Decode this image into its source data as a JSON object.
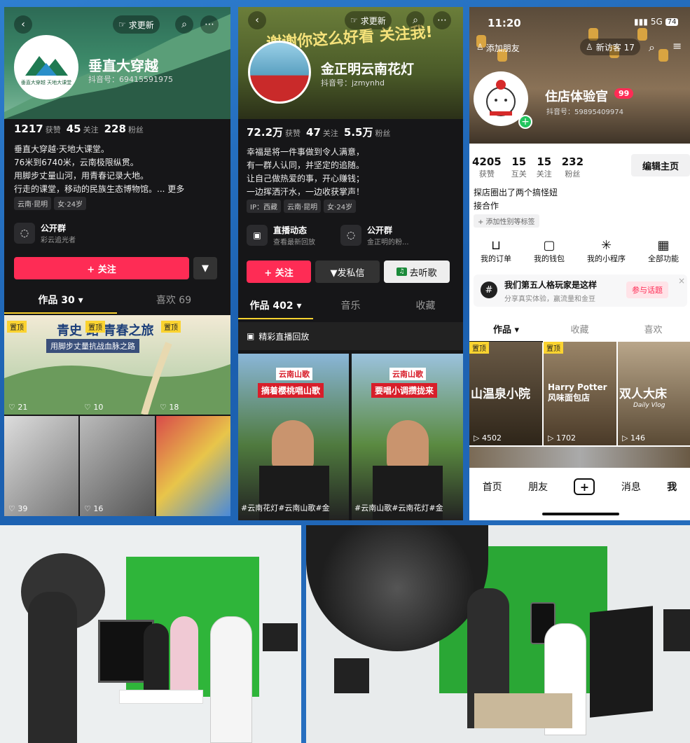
{
  "p1": {
    "name": "垂直大穿越",
    "douyin_id": "抖音号：69415591975",
    "update_btn": "求更新",
    "logo_text": "垂直大穿越 天地大课堂",
    "stats": {
      "likes": "1217",
      "likes_l": "获赞",
      "following": "45",
      "following_l": "关注",
      "fans": "228",
      "fans_l": "粉丝"
    },
    "bio": [
      "垂直大穿越·天地大课堂。",
      "76米到6740米，云南极限纵贯。",
      "用脚步丈量山河，用青春记录大地。",
      "行走的课堂，移动的民族生态博物馆。... 更多"
    ],
    "tags": [
      "云南·昆明",
      "女·24岁"
    ],
    "group_title": "公开群",
    "group_sub": "彩云追光者",
    "follow": "+ 关注",
    "tab_works": "作品 30 ▾",
    "tab_likes": "喜欢 69",
    "banner_title": "青史 路 青春之旅",
    "banner_sub": "用脚步丈量抗战血脉之路",
    "pin": "置顶",
    "thumb_likes": [
      "21",
      "10",
      "18",
      "39",
      "16",
      ""
    ]
  },
  "p2": {
    "name": "金正明云南花灯",
    "douyin_id": "抖音号：jzmynhd",
    "update_btn": "求更新",
    "banner_text": "谢谢你这么好看 关注我!",
    "stats": {
      "likes": "72.2万",
      "likes_l": "获赞",
      "following": "47",
      "following_l": "关注",
      "fans": "5.5万",
      "fans_l": "粉丝"
    },
    "bio": [
      "幸福是将一件事做到令人满意，",
      "有一群人认同，并坚定的追随。",
      "让自己做热爱的事，开心赚钱；",
      "一边挥洒汗水，一边收获掌声！"
    ],
    "tags": [
      "IP：西藏",
      "云南·昆明",
      "女·24岁"
    ],
    "live_title": "直播动态",
    "live_sub": "查看最新回放",
    "group_title": "公开群",
    "group_sub": "金正明的粉...",
    "follow": "+ 关注",
    "message": "▼发私信",
    "listen": "去听歌",
    "tab_works": "作品 402 ▾",
    "tab_music": "音乐",
    "tab_fav": "收藏",
    "replay": "精彩直播回放",
    "v1_title1": "云南山歌",
    "v1_title2": "摘着樱桃唱山歌",
    "v2_title1": "云南山歌",
    "v2_title2": "要唱小调攒拢来",
    "v1_caption": "#云南花灯#云南山歌#金",
    "v2_caption": "#云南山歌#云南花灯#金"
  },
  "p3": {
    "time": "11:20",
    "signal": "5G",
    "battery": "74",
    "add_friend": "添加朋友",
    "visitors": "新访客 17",
    "name": "住店体验官",
    "badge": "99",
    "douyin_id": "抖音号：59895409974",
    "stats": [
      {
        "v": "4205",
        "l": "获赞"
      },
      {
        "v": "15",
        "l": "互关"
      },
      {
        "v": "15",
        "l": "关注"
      },
      {
        "v": "232",
        "l": "粉丝"
      }
    ],
    "edit": "编辑主页",
    "bio1": "探店圈出了两个搞怪妞",
    "bio2": "接合作",
    "add_tag": "+ 添加性别等标签",
    "functions": [
      "我的订单",
      "我的钱包",
      "我的小程序",
      "全部功能"
    ],
    "topic_title": "我们第五人格玩家是这样",
    "topic_sub": "分享真实体验，赢流量和金豆",
    "topic_btn": "参与话题",
    "tab_works": "作品 ▾",
    "tab_fav": "收藏",
    "tab_like": "喜欢",
    "pin": "置顶",
    "t1_text": "山温泉小院",
    "t2_text": "Harry Potter 风味面包店",
    "t3_text": "双人大床",
    "t3_sub": "Daily Vlog",
    "views": [
      "4502",
      "1702",
      "146"
    ],
    "nav": [
      "首页",
      "朋友",
      "消息",
      "我"
    ]
  }
}
